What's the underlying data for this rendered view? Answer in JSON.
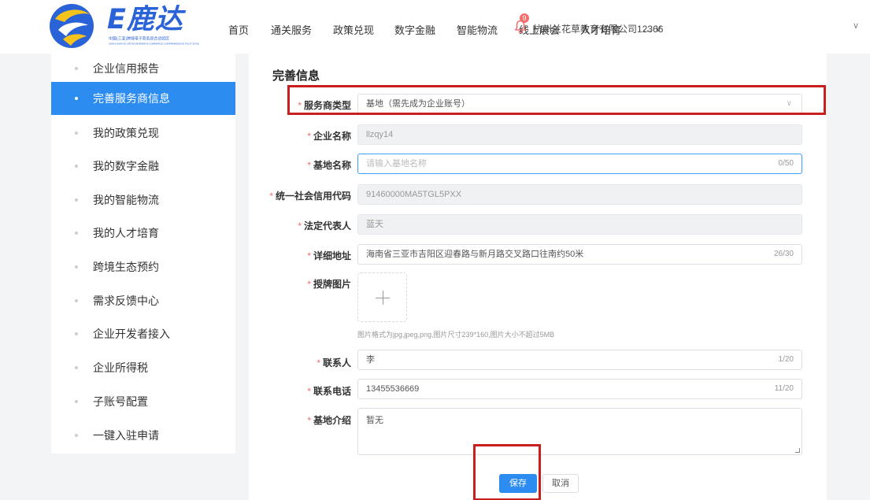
{
  "header": {
    "brand": "E鹿达",
    "brand_subtitle": "中国(三亚)跨境电子商务综合试验区",
    "brand_subtitle_en": "CHINA (SANYA) CROSS-BORDER E-COMMERCE COMPREHENSIVE PILOT ZONE",
    "nav": [
      "首页",
      "通关服务",
      "政策兑现",
      "数字金融",
      "智能物流",
      "线上展会",
      "人才培育",
      "... ∨"
    ],
    "notification_count": "9",
    "company": "杭州兰花草教育有限公司12366",
    "chevron": "∨"
  },
  "sidebar": {
    "items": [
      {
        "label": "企业信用报告",
        "active": false
      },
      {
        "label": "完善服务商信息",
        "active": true
      },
      {
        "label": "我的政策兑现",
        "active": false
      },
      {
        "label": "我的数字金融",
        "active": false
      },
      {
        "label": "我的智能物流",
        "active": false
      },
      {
        "label": "我的人才培育",
        "active": false
      },
      {
        "label": "跨境生态预约",
        "active": false
      },
      {
        "label": "需求反馈中心",
        "active": false
      },
      {
        "label": "企业开发者接入",
        "active": false
      },
      {
        "label": "企业所得税",
        "active": false
      },
      {
        "label": "子账号配置",
        "active": false
      },
      {
        "label": "一键入驻申请",
        "active": false
      }
    ]
  },
  "form": {
    "title": "完善信息",
    "required_mark": "*",
    "service_type": {
      "label": "服务商类型",
      "value": "基地（需先成为企业账号）",
      "chevron": "∨"
    },
    "company_name": {
      "label": "企业名称",
      "value": "llzqy14"
    },
    "base_name": {
      "label": "基地名称",
      "placeholder": "请输入基地名称",
      "count": "0/50"
    },
    "credit_code": {
      "label": "统一社会信用代码",
      "value": "91460000MA5TGL5PXX"
    },
    "legal_rep": {
      "label": "法定代表人",
      "value": "蓝天"
    },
    "address": {
      "label": "详细地址",
      "value": "海南省三亚市吉阳区迎春路与新月路交叉路口往南约50米",
      "count": "26/30"
    },
    "plaque_image": {
      "label": "授牌图片",
      "hint": "图片格式为jpg,jpeg,png,图片尺寸239*160,图片大小不超过5MB"
    },
    "contact": {
      "label": "联系人",
      "value": "李",
      "count": "1/20"
    },
    "phone": {
      "label": "联系电话",
      "value": "13455536669",
      "count": "11/20"
    },
    "intro": {
      "label": "基地介绍",
      "value": "暂无"
    },
    "save_label": "保存",
    "cancel_label": "取消"
  },
  "colors": {
    "accent": "#2d8cf0",
    "required": "#f56c6c",
    "highlight": "#c81e1e",
    "brand": "#2a62d8"
  }
}
